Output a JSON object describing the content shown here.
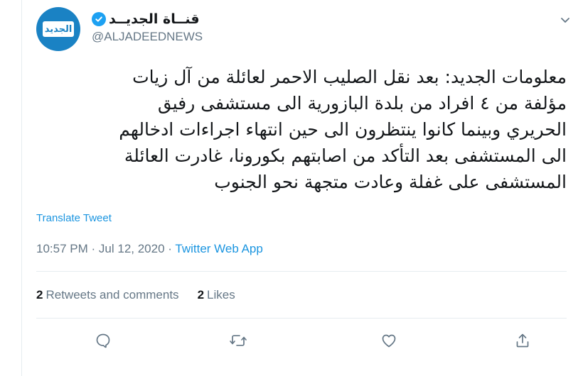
{
  "account": {
    "display_name": "قنــاة الجديــد",
    "handle": "@ALJADEEDNEWS",
    "avatar_text": "الجديد",
    "verified": true
  },
  "tweet": {
    "text": "معلومات الجديد: بعد نقل الصليب الاحمر لعائلة من آل زيات\nمؤلفة من ٤ افراد من بلدة البازورية الى مستشفى رفيق\nالحريري وبينما كانوا ينتظرون الى حين انتهاء اجراءات ادخالهم\nالى المستشفى بعد التأكد من اصابتهم بكورونا، غادرت العائلة\nالمستشفى على غفلة وعادت متجهة نحو الجنوب",
    "translate_label": "Translate Tweet",
    "time": "10:57 PM",
    "date": "Jul 12, 2020",
    "separator": "·",
    "source_app": "Twitter Web App"
  },
  "stats": {
    "retweets_count": "2",
    "retweets_label": "Retweets and comments",
    "likes_count": "2",
    "likes_label": "Likes"
  },
  "icons": {
    "reply": "reply-icon",
    "retweet": "retweet-icon",
    "like": "heart-icon",
    "share": "share-icon",
    "more": "chevron-down-icon",
    "verified": "verified-badge-icon"
  },
  "colors": {
    "accent": "#1da1f2",
    "link": "#1b95e0",
    "muted": "#657786",
    "avatar_bg": "#1a82c4"
  }
}
